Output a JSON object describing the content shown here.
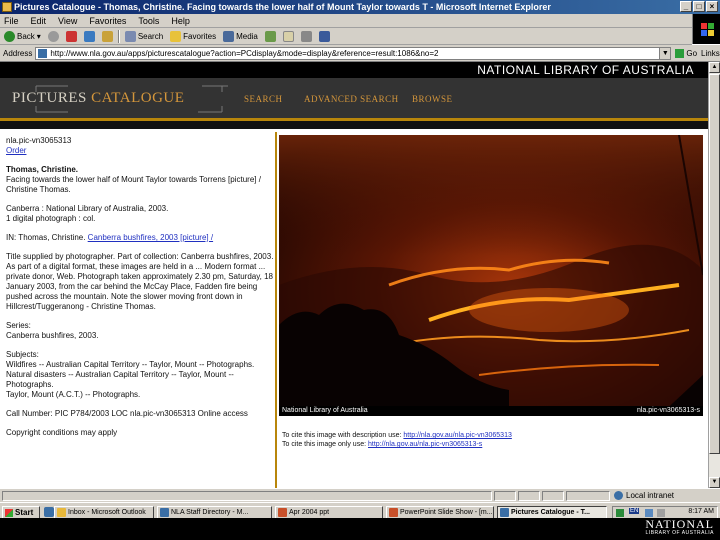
{
  "window": {
    "title": "Pictures Catalogue - Thomas, Christine. Facing towards the lower half of Mount Taylor towards T - Microsoft Internet Explorer",
    "min": "_",
    "max": "□",
    "close": "×"
  },
  "menu": [
    "File",
    "Edit",
    "View",
    "Favorites",
    "Tools",
    "Help"
  ],
  "toolbar": {
    "back": "Back",
    "search": "Search",
    "favorites": "Favorites",
    "media": "Media"
  },
  "address": {
    "label": "Address",
    "url": "http://www.nla.gov.au/apps/picturescatalogue?action=PCdisplay&mode=display&reference=result:1086&no=2",
    "go": "Go",
    "links": "Links"
  },
  "site": {
    "header": "NATIONAL LIBRARY OF AUSTRALIA",
    "logo_part1": "PICTURES",
    "logo_part2": "CATALOGUE",
    "nav": [
      "SEARCH",
      "ADVANCED SEARCH",
      "BROWSE"
    ]
  },
  "record": {
    "id": "nla.pic-vn3065313",
    "order": "Order",
    "author": "Thomas, Christine.",
    "title": "Facing towards the lower half of Mount Taylor towards Torrens [picture] / Christine Thomas.",
    "publication": "Canberra : National Library of Australia, 2003.",
    "physical": "1 digital photograph : col.",
    "in_label": "IN: Thomas, Christine.",
    "in_link": "Canberra bushfires, 2003 [picture] /",
    "notes": "Title supplied by photographer. Part of collection: Canberra bushfires, 2003. As part of a digital format, these images are held in a ... Modern format ... private donor, Web. Photograph taken approximately 2.30 pm, Saturday, 18 January 2003, from the car behind the McCay Place, Fadden fire being pushed across the mountain. Note the slower moving front down in Hillcrest/Tuggeranong - Christine Thomas.",
    "series_label": "Series:",
    "series": "Canberra bushfires, 2003.",
    "subjects_label": "Subjects:",
    "subjects": [
      "Wildfires -- Australian Capital Territory -- Taylor, Mount -- Photographs.",
      "Natural disasters -- Australian Capital Territory -- Taylor, Mount -- Photographs.",
      "Taylor, Mount (A.C.T.) -- Photographs."
    ],
    "call_number": "Call Number: PIC P784/2003 LOC nla.pic-vn3065313 Online access",
    "copyright": "Copyright conditions may apply"
  },
  "photo": {
    "caption_left": "National Library of Australia",
    "caption_right": "nla.pic-vn3065313-s"
  },
  "cite": {
    "line1_label": "To cite this image with description use:",
    "line1_url": "http://nla.gov.au/nla.pic-vn3065313",
    "line2_label": "To cite this image only use:",
    "line2_url": "http://nla.gov.au/nla.pic-vn3065313-s"
  },
  "status": {
    "zone": "Local intranet"
  },
  "taskbar": {
    "start": "Start",
    "tasks": [
      "Inbox - Microsoft Outlook",
      "NLA Staff Directory - M...",
      "Apr 2004 ppt",
      "PowerPoint Slide Show - [m...",
      "Pictures Catalogue - T..."
    ],
    "lang": "EN",
    "clock": "8:17 AM"
  },
  "watermark": {
    "line1": "NATIONAL",
    "line2": "LIBRARY OF AUSTRALIA"
  },
  "colors": {
    "accent": "#b8860b",
    "nav_orange": "#d4963b",
    "link": "#2030c0",
    "title_blue": "#0a246a"
  }
}
